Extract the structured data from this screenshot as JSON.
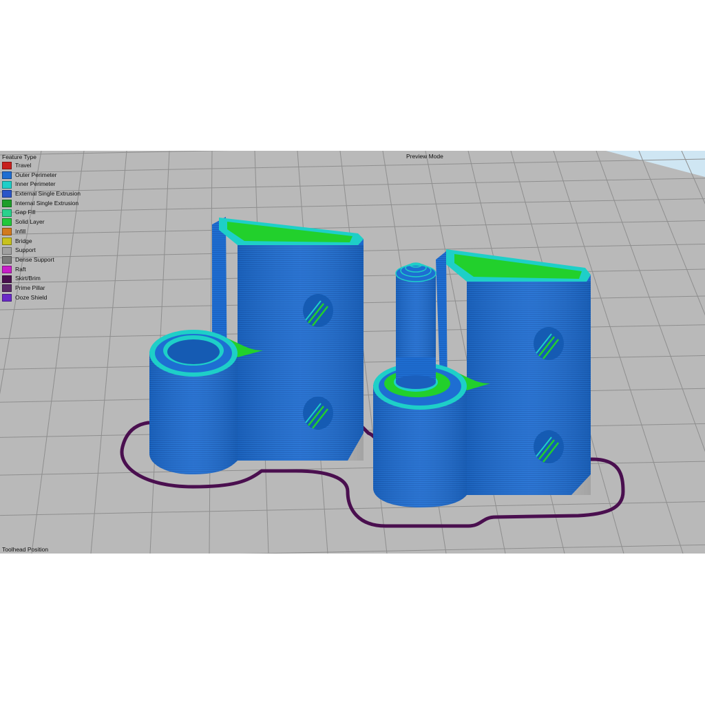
{
  "viewer": {
    "feature_type_title": "Feature Type",
    "preview_mode_label": "Preview Mode",
    "toolhead_position_label": "Toolhead Position"
  },
  "legend": [
    {
      "label": "Travel",
      "color": "#c8201e"
    },
    {
      "label": "Outer Perimeter",
      "color": "#1e6ed2"
    },
    {
      "label": "Inner Perimeter",
      "color": "#1ecfc8"
    },
    {
      "label": "External Single Extrusion",
      "color": "#2a55c8"
    },
    {
      "label": "Internal Single Extrusion",
      "color": "#1e9e2a"
    },
    {
      "label": "Gap Fill",
      "color": "#2ad28c"
    },
    {
      "label": "Solid Layer",
      "color": "#22c83a"
    },
    {
      "label": "Infill",
      "color": "#d27a1e"
    },
    {
      "label": "Bridge",
      "color": "#c8c21e"
    },
    {
      "label": "Support",
      "color": "#a0a0a0"
    },
    {
      "label": "Dense Support",
      "color": "#7a7a7a"
    },
    {
      "label": "Raft",
      "color": "#c81ec8"
    },
    {
      "label": "Skirt/Brim",
      "color": "#4a0f4f"
    },
    {
      "label": "Prime Pillar",
      "color": "#5a2a6a"
    },
    {
      "label": "Ooze Shield",
      "color": "#6a2ac8"
    }
  ],
  "colors": {
    "bed": "#b9b9b9",
    "grid": "#8e8e8e",
    "outer_perimeter": "#1e6ed2",
    "inner_perimeter": "#1ecfc8",
    "solid_layer": "#22d02c",
    "skirt": "#4a0f4f",
    "sky": "#cfe6f3"
  }
}
